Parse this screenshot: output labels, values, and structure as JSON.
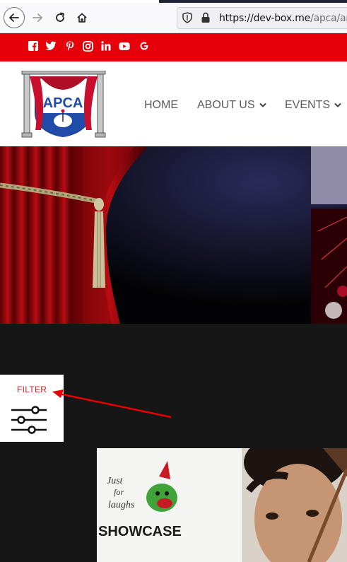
{
  "browser": {
    "url_host": "https://dev-box.me",
    "url_path": "/apca/artis",
    "icons": [
      "back-arrow-icon",
      "forward-arrow-icon",
      "reload-icon",
      "home-icon",
      "shield-icon",
      "lock-icon"
    ]
  },
  "social": {
    "icons": [
      "facebook-icon",
      "twitter-icon",
      "pinterest-icon",
      "instagram-icon",
      "linkedin-icon",
      "youtube-icon",
      "google-icon"
    ],
    "color": "#e6000a"
  },
  "logo": {
    "text": "APCA"
  },
  "nav": {
    "home": "HOME",
    "about": "ABOUT US",
    "events": "EVENTS"
  },
  "filter": {
    "label": "FILTER"
  },
  "card": {
    "line1": "Just",
    "line2": "for",
    "line3": "laughs",
    "line4": "SHOWCASE"
  }
}
